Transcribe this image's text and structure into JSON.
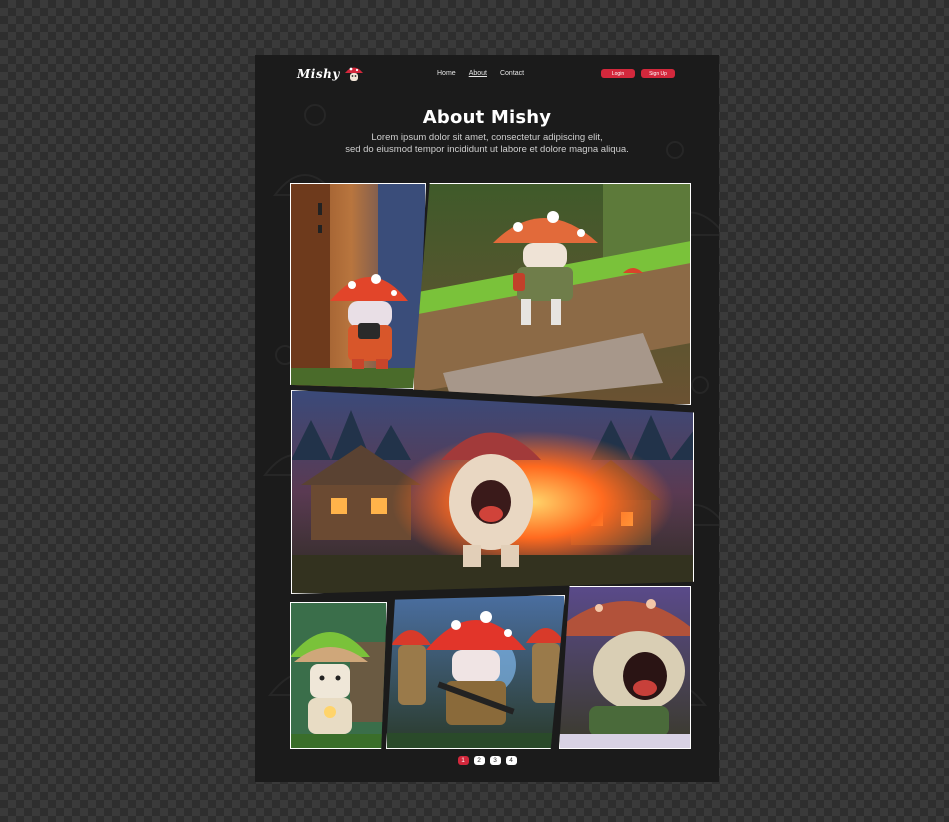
{
  "frame": {
    "label": ""
  },
  "brand": {
    "name": "Mishy",
    "accent": "#d3283c",
    "background": "#1b1b1b",
    "logo_icon": "mushroom-mascot-icon"
  },
  "nav": {
    "links": [
      {
        "label": "Home",
        "active": false
      },
      {
        "label": "About",
        "active": true
      },
      {
        "label": "Contact",
        "active": false
      }
    ],
    "login_label": "Login",
    "signup_label": "Sign Up"
  },
  "hero": {
    "title": "About Mishy",
    "description_line1": "Lorem ipsum dolor sit amet, consectetur adipiscing elit,",
    "description_line2": "sed do eiusmod tempor incididunt ut labore et dolore magna aliqua."
  },
  "gallery": {
    "panels": [
      {
        "scene": "mushroom-at-wooden-door"
      },
      {
        "scene": "mushroom-sitting-on-mossy-log"
      },
      {
        "scene": "mushroom-screaming-burning-village"
      },
      {
        "scene": "mushroom-mossy-cap-house"
      },
      {
        "scene": "mushroom-soldiers-with-rifles"
      },
      {
        "scene": "mushroom-screaming-closeup"
      }
    ]
  },
  "pagination": {
    "pages": [
      "1",
      "2",
      "3",
      "4"
    ],
    "current": "1"
  }
}
